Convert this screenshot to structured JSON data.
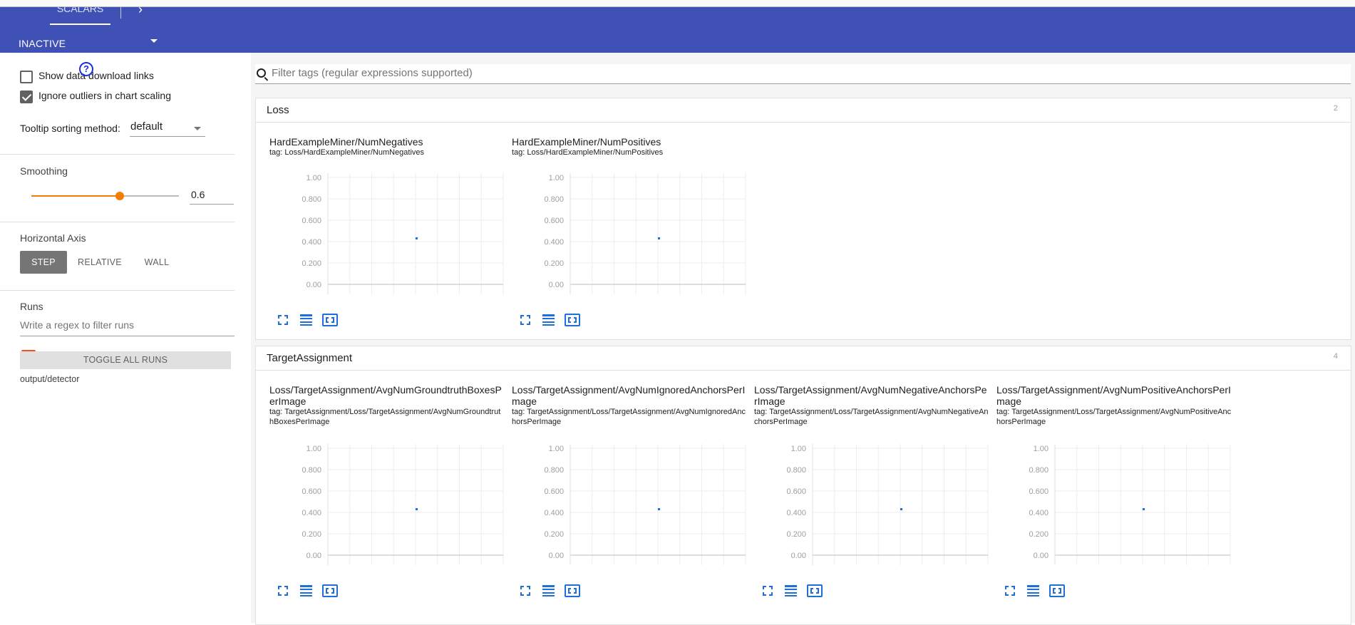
{
  "header": {
    "tab_label": "SCALARS",
    "run_select_value": "INACTIVE"
  },
  "sidebar": {
    "show_download_label": "Show data download links",
    "show_download_checked": false,
    "ignore_outliers_label": "Ignore outliers in chart scaling",
    "ignore_outliers_checked": true,
    "help_glyph": "?",
    "tooltip_sort_label": "Tooltip sorting method:",
    "tooltip_sort_value": "default",
    "smoothing_title": "Smoothing",
    "smoothing_value": "0.6",
    "smoothing_fraction": 0.6,
    "horizontal_axis_title": "Horizontal Axis",
    "axis_options": [
      "STEP",
      "RELATIVE",
      "WALL"
    ],
    "axis_selected": "STEP",
    "runs_title": "Runs",
    "runs_filter_placeholder": "Write a regex to filter runs",
    "toggle_all_label": "TOGGLE ALL RUNS",
    "run_name": "output/detector",
    "run_color": "#f4511e"
  },
  "main": {
    "search_placeholder": "Filter tags (regular expressions supported)",
    "accent_color": "#1e6fd9",
    "groups": [
      {
        "title": "Loss",
        "count": "2",
        "cards": [
          {
            "title": "HardExampleMiner/NumNegatives",
            "tag": "tag: Loss/HardExampleMiner/NumNegatives"
          },
          {
            "title": "HardExampleMiner/NumPositives",
            "tag": "tag: Loss/HardExampleMiner/NumPositives"
          }
        ]
      },
      {
        "title": "TargetAssignment",
        "count": "4",
        "cards": [
          {
            "title": "Loss/TargetAssignment/AvgNumGroundtruthBoxesPerImage",
            "tag": "tag: TargetAssignment/Loss/TargetAssignment/AvgNumGroundtruthBoxesPerImage"
          },
          {
            "title": "Loss/TargetAssignment/AvgNumIgnoredAnchorsPerImage",
            "tag": "tag: TargetAssignment/Loss/TargetAssignment/AvgNumIgnoredAnchorsPerImage"
          },
          {
            "title": "Loss/TargetAssignment/AvgNumNegativeAnchorsPerImage",
            "tag": "tag: TargetAssignment/Loss/TargetAssignment/AvgNumNegativeAnchorsPerImage"
          },
          {
            "title": "Loss/TargetAssignment/AvgNumPositiveAnchorsPerImage",
            "tag": "tag: TargetAssignment/Loss/TargetAssignment/AvgNumPositiveAnchorsPerImage"
          }
        ]
      }
    ]
  },
  "chart_data": {
    "type": "scatter",
    "yticks": [
      "1.00",
      "0.800",
      "0.600",
      "0.400",
      "0.200",
      "0.00"
    ],
    "ylim": [
      0,
      1
    ],
    "grid": true,
    "point_y": 0.43,
    "point_color": "#1e6fd9"
  }
}
